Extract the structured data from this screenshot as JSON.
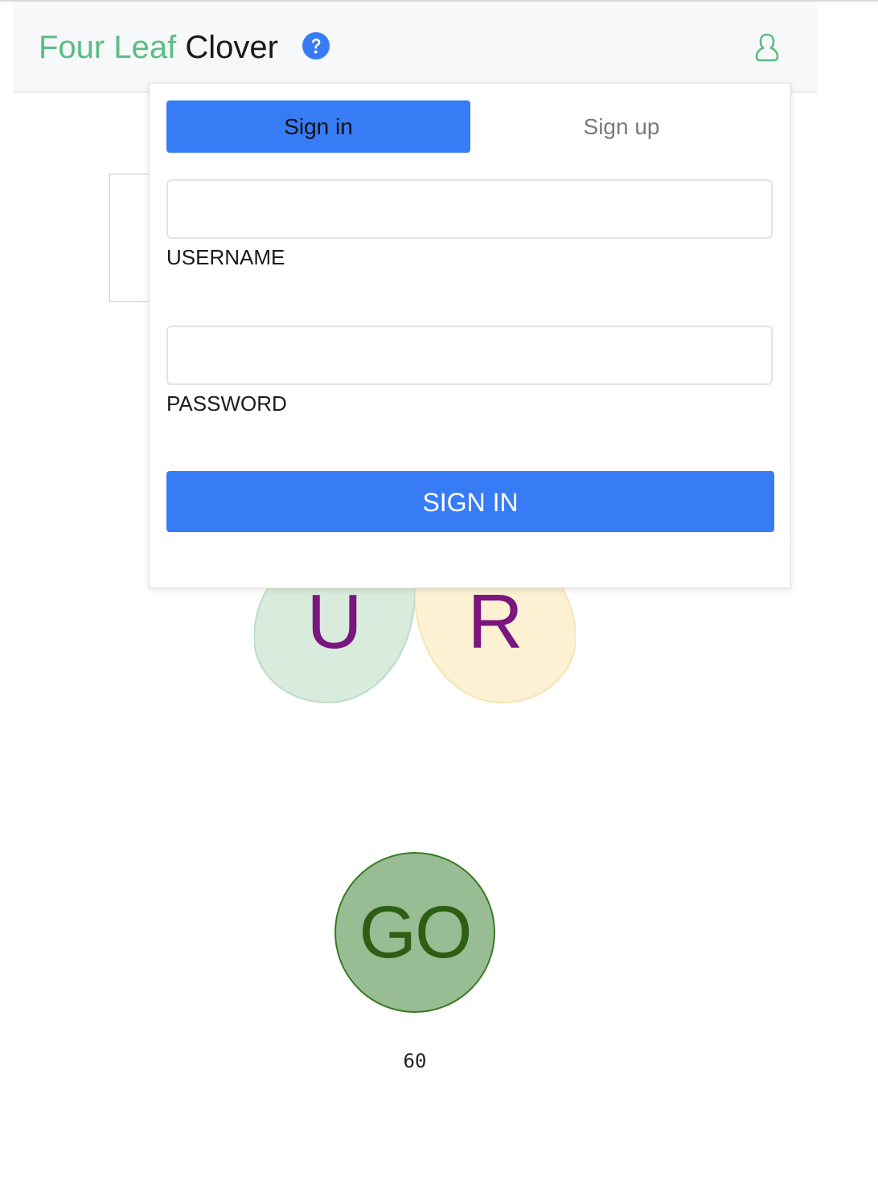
{
  "header": {
    "brand_part1": "Four Leaf",
    "brand_part2": "Clover",
    "help_icon": "help-circle-icon",
    "user_icon": "user-icon",
    "brand_color": "#5bbd84"
  },
  "auth_popover": {
    "tabs": [
      {
        "label": "Sign in",
        "active": true
      },
      {
        "label": "Sign up",
        "active": false
      }
    ],
    "username_label": "USERNAME",
    "username_value": "",
    "password_label": "PASSWORD",
    "password_value": "",
    "submit_label": "SIGN IN",
    "accent_color": "#377cf5"
  },
  "game": {
    "leaves": [
      {
        "letter": "U",
        "color": "#d8ebdc"
      },
      {
        "letter": "R",
        "color": "#fcf1d2"
      }
    ],
    "letter_color": "#7a167e",
    "go_label": "GO",
    "timer": "60"
  }
}
